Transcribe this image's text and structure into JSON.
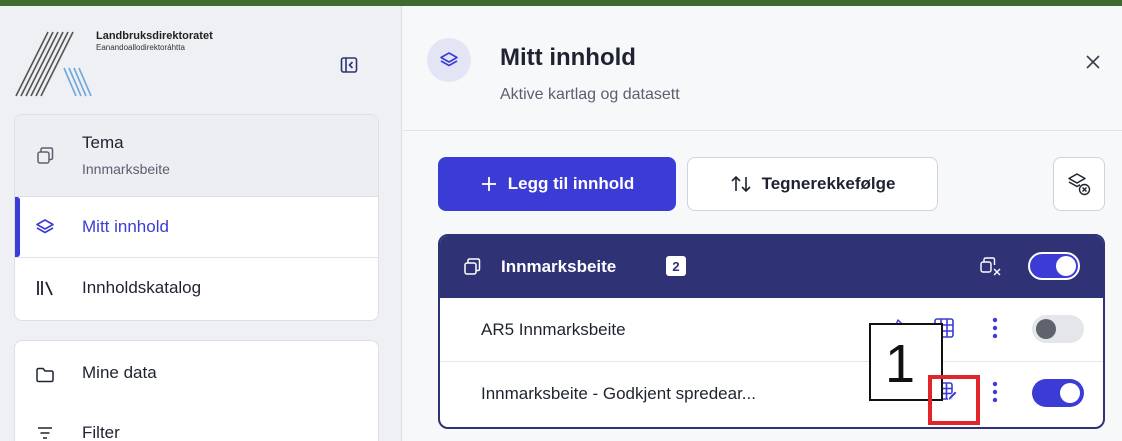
{
  "logo": {
    "title": "Landbruksdirektoratet",
    "subtitle": "Eanandoallodirektoráhtta"
  },
  "sidebar": {
    "theme": {
      "label": "Tema",
      "value": "Innmarksbeite"
    },
    "items": [
      {
        "label": "Mitt innhold",
        "active": true,
        "icon": "layers-icon"
      },
      {
        "label": "Innholdskatalog",
        "active": false,
        "icon": "library-icon"
      }
    ],
    "secondary": [
      {
        "label": "Mine data",
        "icon": "folder-icon"
      },
      {
        "label": "Filter",
        "icon": "filter-icon"
      }
    ]
  },
  "panel": {
    "title": "Mitt innhold",
    "subtitle": "Aktive kartlag og datasett",
    "add_button": "Legg til innhold",
    "order_button": "Tegnerekkefølge"
  },
  "group": {
    "title": "Innmarksbeite",
    "count": "2",
    "enabled": true,
    "layers": [
      {
        "name": "AR5 Innmarksbeite",
        "enabled": false
      },
      {
        "name": "Innmarksbeite - Godkjent spredear...",
        "enabled": true
      }
    ]
  },
  "annotation": {
    "label": "1"
  },
  "colors": {
    "accent": "#3b3bd6",
    "group_header": "#2f3274",
    "highlight": "#e0262b",
    "background_frame": "#3f6b2f"
  }
}
